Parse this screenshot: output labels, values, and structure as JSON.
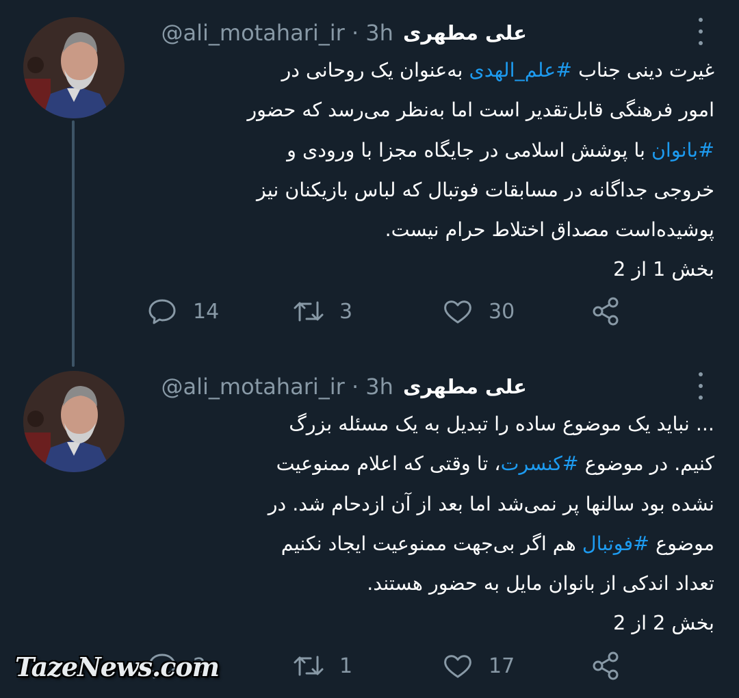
{
  "tweets": [
    {
      "author_name": "علی مطهری",
      "handle": "@ali_motahari_ir · 3h",
      "lines": [
        {
          "pre": "غیرت دینی جناب ",
          "tag": "#علم_الهدی",
          "post": " به‌عنوان یک روحانی در"
        },
        {
          "pre": "امور فرهنگی قابل‌تقدیر است اما به‌نظر می‌رسد که حضور",
          "tag": "",
          "post": ""
        },
        {
          "pre": "",
          "tag": "#بانوان",
          "post": " با پوشش اسلامی در جایگاه مجزا با ورودی و"
        },
        {
          "pre": "خروجی جداگانه در مسابقات فوتبال که لباس بازیکنان نیز",
          "tag": "",
          "post": ""
        },
        {
          "pre": "پوشیده‌است مصداق اختلاط حرام نیست.",
          "tag": "",
          "post": ""
        },
        {
          "pre": "بخش 1 از 2",
          "tag": "",
          "post": ""
        }
      ],
      "replies": "14",
      "retweets": "3",
      "likes": "30"
    },
    {
      "author_name": "علی مطهری",
      "handle": "@ali_motahari_ir · 3h",
      "lines": [
        {
          "pre": "... نباید یک موضوع ساده را تبدیل به یک مسئله بزرگ",
          "tag": "",
          "post": ""
        },
        {
          "pre": "کنیم. در موضوع ",
          "tag": "#کنسرت",
          "post": "، تا وقتی که اعلام ممنوعیت"
        },
        {
          "pre": "نشده بود سالنها پر نمی‌شد اما بعد از آن ازدحام شد. در",
          "tag": "",
          "post": ""
        },
        {
          "pre": "موضوع ",
          "tag": "#فوتبال",
          "post": " هم اگر بی‌جهت ممنوعیت ایجاد نکنیم"
        },
        {
          "pre": "تعداد اندکی از بانوان مایل به حضور هستند.",
          "tag": "",
          "post": ""
        },
        {
          "pre": "بخش 2 از 2",
          "tag": "",
          "post": ""
        }
      ],
      "replies": "2",
      "retweets": "1",
      "likes": "17"
    }
  ],
  "watermark": "TazeNews.com",
  "colors": {
    "background": "#15202b",
    "hashtag": "#1d9bf0",
    "muted": "#8899a6"
  },
  "icons": [
    "reply-icon",
    "retweet-icon",
    "like-icon",
    "share-icon",
    "more-icon"
  ]
}
